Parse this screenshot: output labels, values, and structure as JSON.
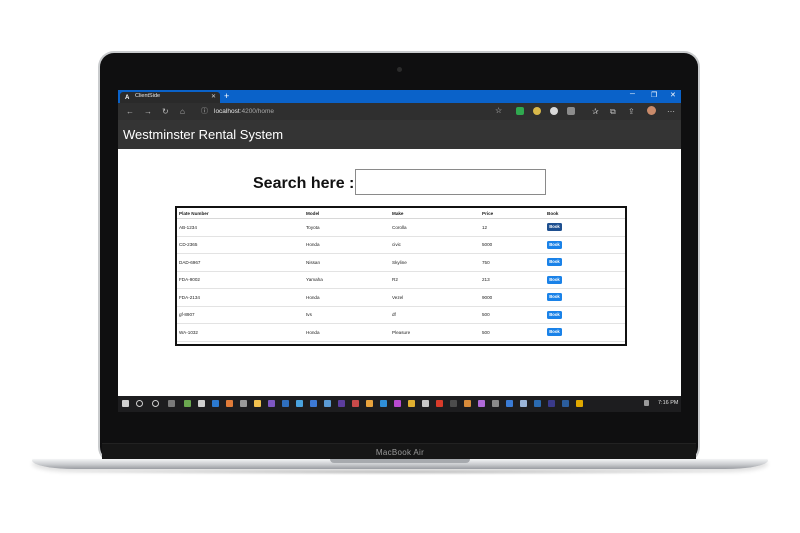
{
  "browser": {
    "tab_title": "ClientSide",
    "tab_logo": "A",
    "new_tab": "+",
    "url_host": "localhost",
    "url_path": ":4200/home",
    "controls": {
      "minimize": "─",
      "restore": "❐",
      "close": "✕"
    }
  },
  "app": {
    "title": "Westminster Rental System",
    "search_label": "Search here :",
    "search_value": ""
  },
  "table": {
    "headers": [
      "Plate Number",
      "Model",
      "Make",
      "Price",
      "Book"
    ],
    "rows": [
      {
        "plate": "AB-1234",
        "model": "Toyota",
        "make": "Corolla",
        "price": "12",
        "book": "Book"
      },
      {
        "plate": "CD-2365",
        "model": "Honda",
        "make": "civic",
        "price": "5000",
        "book": "Book"
      },
      {
        "plate": "DAD-6967",
        "model": "Nissan",
        "make": "Skyline",
        "price": "750",
        "book": "Book"
      },
      {
        "plate": "FDA-9002",
        "model": "Yamaha",
        "make": "R2",
        "price": "213",
        "book": "Book"
      },
      {
        "plate": "FDA-2134",
        "model": "Honda",
        "make": "Vezel",
        "price": "9000",
        "book": "Book"
      },
      {
        "plate": "gf-8907",
        "model": "tvs",
        "make": "df",
        "price": "500",
        "book": "Book"
      },
      {
        "plate": "WA-1032",
        "model": "Honda",
        "make": "Pleasure",
        "price": "500",
        "book": "Book"
      }
    ]
  },
  "taskbar": {
    "time": "7:16 PM"
  },
  "laptop": {
    "brand": "MacBook Air"
  },
  "colors": {
    "tab_strip": "#0a62c9",
    "app_header": "#343434",
    "book_button": "#1a82e8",
    "book_button_active": "#1e4f8f"
  }
}
